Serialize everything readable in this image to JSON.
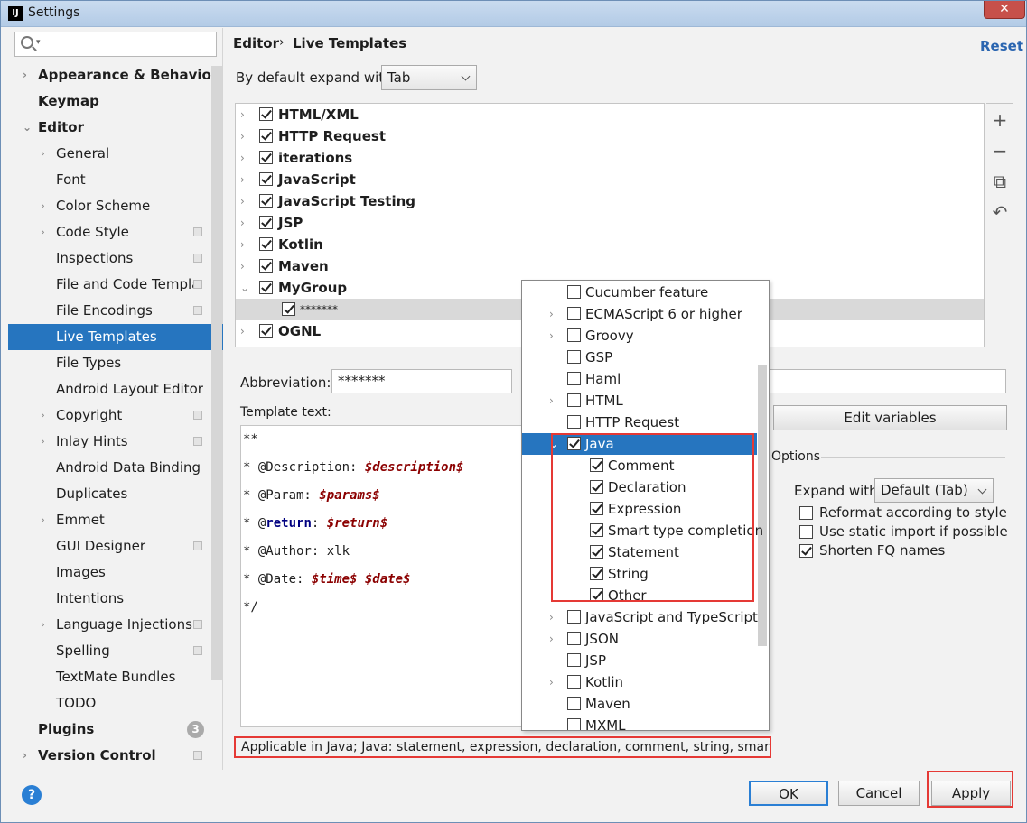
{
  "window": {
    "title": "Settings",
    "app_icon": "IJ"
  },
  "sidebar": {
    "search_placeholder": "",
    "items": [
      {
        "label": "Appearance & Behavior",
        "arrow": "›",
        "bold": true
      },
      {
        "label": "Keymap",
        "bold": true
      },
      {
        "label": "Editor",
        "arrow": "⌄",
        "bold": true
      },
      {
        "label": "General",
        "arrow": "›"
      },
      {
        "label": "Font"
      },
      {
        "label": "Color Scheme",
        "arrow": "›"
      },
      {
        "label": "Code Style",
        "arrow": "›",
        "icon": "config-icon"
      },
      {
        "label": "Inspections",
        "icon": "config-icon"
      },
      {
        "label": "File and Code Templa",
        "icon": "config-icon"
      },
      {
        "label": "File Encodings",
        "icon": "config-icon"
      },
      {
        "label": "Live Templates",
        "selected": true
      },
      {
        "label": "File Types"
      },
      {
        "label": "Android Layout Editor"
      },
      {
        "label": "Copyright",
        "arrow": "›",
        "icon": "config-icon"
      },
      {
        "label": "Inlay Hints",
        "arrow": "›",
        "icon": "config-icon"
      },
      {
        "label": "Android Data Binding"
      },
      {
        "label": "Duplicates"
      },
      {
        "label": "Emmet",
        "arrow": "›"
      },
      {
        "label": "GUI Designer",
        "icon": "config-icon"
      },
      {
        "label": "Images"
      },
      {
        "label": "Intentions"
      },
      {
        "label": "Language Injections",
        "arrow": "›",
        "icon": "config-icon"
      },
      {
        "label": "Spelling",
        "icon": "config-icon"
      },
      {
        "label": "TextMate Bundles"
      },
      {
        "label": "TODO"
      },
      {
        "label": "Plugins",
        "bold": true,
        "badge": "3"
      },
      {
        "label": "Version Control",
        "arrow": "›",
        "bold": true,
        "icon": "config-icon"
      }
    ]
  },
  "breadcrumb": {
    "parent": "Editor",
    "separator": "›",
    "current": "Live Templates"
  },
  "reset_label": "Reset",
  "expand_default": {
    "label": "By default expand with",
    "value": "Tab"
  },
  "templates": [
    {
      "label": "HTML/XML",
      "arrow": "›",
      "checked": true
    },
    {
      "label": "HTTP Request",
      "arrow": "›",
      "checked": true
    },
    {
      "label": "iterations",
      "arrow": "›",
      "checked": true
    },
    {
      "label": "JavaScript",
      "arrow": "›",
      "checked": true
    },
    {
      "label": "JavaScript Testing",
      "arrow": "›",
      "checked": true
    },
    {
      "label": "JSP",
      "arrow": "›",
      "checked": true
    },
    {
      "label": "Kotlin",
      "arrow": "›",
      "checked": true
    },
    {
      "label": "Maven",
      "arrow": "›",
      "checked": true
    },
    {
      "label": "MyGroup",
      "arrow": "⌄",
      "checked": true
    },
    {
      "label": "*******",
      "checked": true,
      "child": true,
      "highlight": true
    },
    {
      "label": "OGNL",
      "arrow": "›",
      "checked": true
    }
  ],
  "tools": [
    "+",
    "−",
    "⧉",
    "↶"
  ],
  "abbreviation": {
    "label": "Abbreviation:",
    "value": "*******"
  },
  "template_text": {
    "label": "Template text:",
    "lines": [
      [
        {
          "t": "**"
        }
      ],
      [
        {
          "t": "* @Description: "
        },
        {
          "t": "$description$",
          "c": "var"
        }
      ],
      [
        {
          "t": "* @Param: "
        },
        {
          "t": "$params$",
          "c": "var"
        }
      ],
      [
        {
          "t": "* @"
        },
        {
          "t": "return",
          "c": "kw"
        },
        {
          "t": ": "
        },
        {
          "t": "$return$",
          "c": "var"
        }
      ],
      [
        {
          "t": "* @Author: xlk"
        }
      ],
      [
        {
          "t": "* @Date: "
        },
        {
          "t": "$time$",
          "c": "var"
        },
        {
          "t": " "
        },
        {
          "t": "$date$",
          "c": "var"
        }
      ],
      [
        {
          "t": "*/"
        }
      ]
    ]
  },
  "edit_variables_label": "Edit variables",
  "options": {
    "title": "Options",
    "expand_with_label": "Expand with",
    "expand_with_value": "Default (Tab)",
    "checkboxes": [
      {
        "label": "Reformat according to style",
        "checked": false
      },
      {
        "label": "Use static import if possible",
        "checked": false
      },
      {
        "label": "Shorten FQ names",
        "checked": true
      }
    ]
  },
  "popup": {
    "items": [
      {
        "label": "Cucumber feature",
        "checked": false
      },
      {
        "label": "ECMAScript 6 or higher",
        "checked": false,
        "arrow": "›"
      },
      {
        "label": "Groovy",
        "checked": false,
        "arrow": "›"
      },
      {
        "label": "GSP",
        "checked": false
      },
      {
        "label": "Haml",
        "checked": false
      },
      {
        "label": "HTML",
        "checked": false,
        "arrow": "›"
      },
      {
        "label": "HTTP Request",
        "checked": false
      },
      {
        "label": "Java",
        "checked": true,
        "arrow": "⌄",
        "selected": true
      },
      {
        "label": "Comment",
        "checked": true,
        "child": true
      },
      {
        "label": "Declaration",
        "checked": true,
        "child": true
      },
      {
        "label": "Expression",
        "checked": true,
        "child": true
      },
      {
        "label": "Smart type completion",
        "checked": true,
        "child": true
      },
      {
        "label": "Statement",
        "checked": true,
        "child": true
      },
      {
        "label": "String",
        "checked": true,
        "child": true
      },
      {
        "label": "Other",
        "checked": true,
        "child": true
      },
      {
        "label": "JavaScript and TypeScript",
        "checked": false,
        "arrow": "›"
      },
      {
        "label": "JSON",
        "checked": false,
        "arrow": "›"
      },
      {
        "label": "JSP",
        "checked": false
      },
      {
        "label": "Kotlin",
        "checked": false,
        "arrow": "›"
      },
      {
        "label": "Maven",
        "checked": false
      },
      {
        "label": "MXML",
        "checked": false
      }
    ]
  },
  "applicable_text": "Applicable in Java; Java: statement, expression, declaration, comment, string, smart typ",
  "buttons": {
    "ok": "OK",
    "cancel": "Cancel",
    "apply": "Apply",
    "help": "?"
  },
  "colors": {
    "selection": "#2675bf",
    "highlight_box": "#e53935",
    "link": "#2a65b0"
  }
}
